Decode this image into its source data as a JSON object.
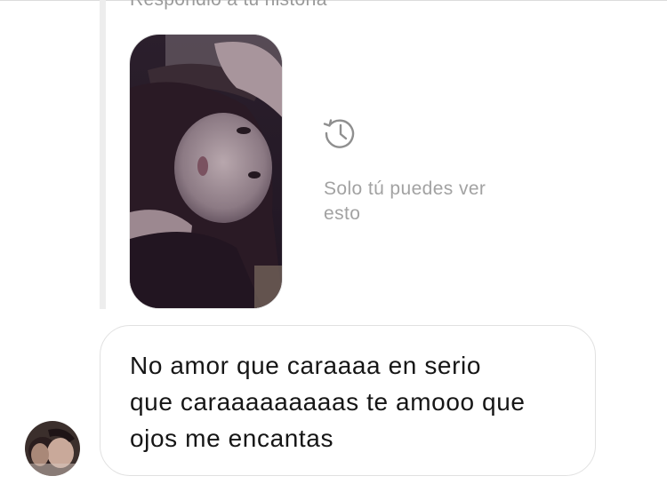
{
  "story_reply": {
    "caption": "Respondió a tu historia",
    "thumbnail_icon": "story-photo-thumbnail"
  },
  "expired_notice": {
    "icon": "history-icon",
    "text": "Solo tú puedes ver esto"
  },
  "message": {
    "avatar_icon": "sender-avatar",
    "text": "No amor que caraaaa en serio\nque caraaaaaaaaas te amooo que\nojos me encantas"
  },
  "colors": {
    "muted_text": "#a2a2a2",
    "bubble_border": "#e1e1e1",
    "quote_bar": "#ededed",
    "message_text": "#161616"
  }
}
